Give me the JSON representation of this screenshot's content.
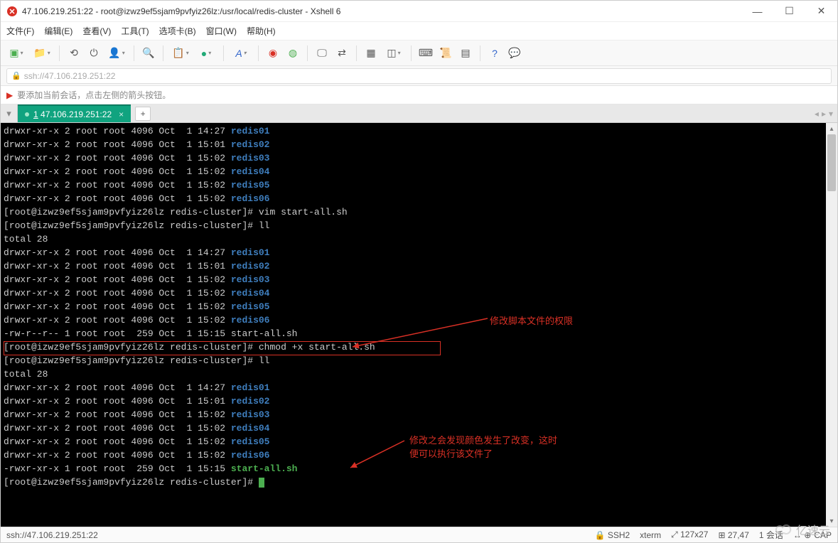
{
  "titlebar": {
    "title": "47.106.219.251:22 - root@izwz9ef5sjam9pvfyiz26lz:/usr/local/redis-cluster - Xshell 6"
  },
  "menu": {
    "file": "文件(F)",
    "edit": "编辑(E)",
    "view": "查看(V)",
    "tools": "工具(T)",
    "tabs": "选项卡(B)",
    "window": "窗口(W)",
    "help": "帮助(H)"
  },
  "addressbar": {
    "value": "ssh://47.106.219.251:22"
  },
  "hint": {
    "text": "要添加当前会话，点击左侧的箭头按钮。"
  },
  "tab": {
    "label": "1 47.106.219.251:22"
  },
  "annotations": {
    "a1": "修改脚本文件的权限",
    "a2_line1": "修改之会发现颜色发生了改变，这时",
    "a2_line2": "便可以执行该文件了"
  },
  "terminal": {
    "ls1": [
      {
        "perm": "drwxr-xr-x",
        "n": "2",
        "u": "root",
        "g": "root",
        "sz": "4096",
        "m": "Oct",
        "d": " 1",
        "t": "14:27",
        "name": "redis01",
        "cls": "dir"
      },
      {
        "perm": "drwxr-xr-x",
        "n": "2",
        "u": "root",
        "g": "root",
        "sz": "4096",
        "m": "Oct",
        "d": " 1",
        "t": "15:01",
        "name": "redis02",
        "cls": "dir"
      },
      {
        "perm": "drwxr-xr-x",
        "n": "2",
        "u": "root",
        "g": "root",
        "sz": "4096",
        "m": "Oct",
        "d": " 1",
        "t": "15:02",
        "name": "redis03",
        "cls": "dir"
      },
      {
        "perm": "drwxr-xr-x",
        "n": "2",
        "u": "root",
        "g": "root",
        "sz": "4096",
        "m": "Oct",
        "d": " 1",
        "t": "15:02",
        "name": "redis04",
        "cls": "dir"
      },
      {
        "perm": "drwxr-xr-x",
        "n": "2",
        "u": "root",
        "g": "root",
        "sz": "4096",
        "m": "Oct",
        "d": " 1",
        "t": "15:02",
        "name": "redis05",
        "cls": "dir"
      },
      {
        "perm": "drwxr-xr-x",
        "n": "2",
        "u": "root",
        "g": "root",
        "sz": "4096",
        "m": "Oct",
        "d": " 1",
        "t": "15:02",
        "name": "redis06",
        "cls": "dir"
      }
    ],
    "prompt": "[root@izwz9ef5sjam9pvfyiz26lz redis-cluster]#",
    "cmd_vim": "vim start-all.sh",
    "cmd_ll": "ll",
    "total": "total 28",
    "ls2": [
      {
        "perm": "drwxr-xr-x",
        "n": "2",
        "u": "root",
        "g": "root",
        "sz": "4096",
        "m": "Oct",
        "d": " 1",
        "t": "14:27",
        "name": "redis01",
        "cls": "dir"
      },
      {
        "perm": "drwxr-xr-x",
        "n": "2",
        "u": "root",
        "g": "root",
        "sz": "4096",
        "m": "Oct",
        "d": " 1",
        "t": "15:01",
        "name": "redis02",
        "cls": "dir"
      },
      {
        "perm": "drwxr-xr-x",
        "n": "2",
        "u": "root",
        "g": "root",
        "sz": "4096",
        "m": "Oct",
        "d": " 1",
        "t": "15:02",
        "name": "redis03",
        "cls": "dir"
      },
      {
        "perm": "drwxr-xr-x",
        "n": "2",
        "u": "root",
        "g": "root",
        "sz": "4096",
        "m": "Oct",
        "d": " 1",
        "t": "15:02",
        "name": "redis04",
        "cls": "dir"
      },
      {
        "perm": "drwxr-xr-x",
        "n": "2",
        "u": "root",
        "g": "root",
        "sz": "4096",
        "m": "Oct",
        "d": " 1",
        "t": "15:02",
        "name": "redis05",
        "cls": "dir"
      },
      {
        "perm": "drwxr-xr-x",
        "n": "2",
        "u": "root",
        "g": "root",
        "sz": "4096",
        "m": "Oct",
        "d": " 1",
        "t": "15:02",
        "name": "redis06",
        "cls": "dir"
      },
      {
        "perm": "-rw-r--r--",
        "n": "1",
        "u": "root",
        "g": "root",
        "sz": " 259",
        "m": "Oct",
        "d": " 1",
        "t": "15:15",
        "name": "start-all.sh",
        "cls": ""
      }
    ],
    "cmd_chmod": "chmod +x start-all.sh",
    "ls3": [
      {
        "perm": "drwxr-xr-x",
        "n": "2",
        "u": "root",
        "g": "root",
        "sz": "4096",
        "m": "Oct",
        "d": " 1",
        "t": "14:27",
        "name": "redis01",
        "cls": "dir"
      },
      {
        "perm": "drwxr-xr-x",
        "n": "2",
        "u": "root",
        "g": "root",
        "sz": "4096",
        "m": "Oct",
        "d": " 1",
        "t": "15:01",
        "name": "redis02",
        "cls": "dir"
      },
      {
        "perm": "drwxr-xr-x",
        "n": "2",
        "u": "root",
        "g": "root",
        "sz": "4096",
        "m": "Oct",
        "d": " 1",
        "t": "15:02",
        "name": "redis03",
        "cls": "dir"
      },
      {
        "perm": "drwxr-xr-x",
        "n": "2",
        "u": "root",
        "g": "root",
        "sz": "4096",
        "m": "Oct",
        "d": " 1",
        "t": "15:02",
        "name": "redis04",
        "cls": "dir"
      },
      {
        "perm": "drwxr-xr-x",
        "n": "2",
        "u": "root",
        "g": "root",
        "sz": "4096",
        "m": "Oct",
        "d": " 1",
        "t": "15:02",
        "name": "redis05",
        "cls": "dir"
      },
      {
        "perm": "drwxr-xr-x",
        "n": "2",
        "u": "root",
        "g": "root",
        "sz": "4096",
        "m": "Oct",
        "d": " 1",
        "t": "15:02",
        "name": "redis06",
        "cls": "dir"
      },
      {
        "perm": "-rwxr-xr-x",
        "n": "1",
        "u": "root",
        "g": "root",
        "sz": " 259",
        "m": "Oct",
        "d": " 1",
        "t": "15:15",
        "name": "start-all.sh",
        "cls": "exe"
      }
    ]
  },
  "status": {
    "left": "ssh://47.106.219.251:22",
    "ssh": "SSH2",
    "term": "xterm",
    "size": "127x27",
    "pos": "27,47",
    "sess": "1 会话",
    "cap": "CAP"
  },
  "watermark": "亿速云"
}
